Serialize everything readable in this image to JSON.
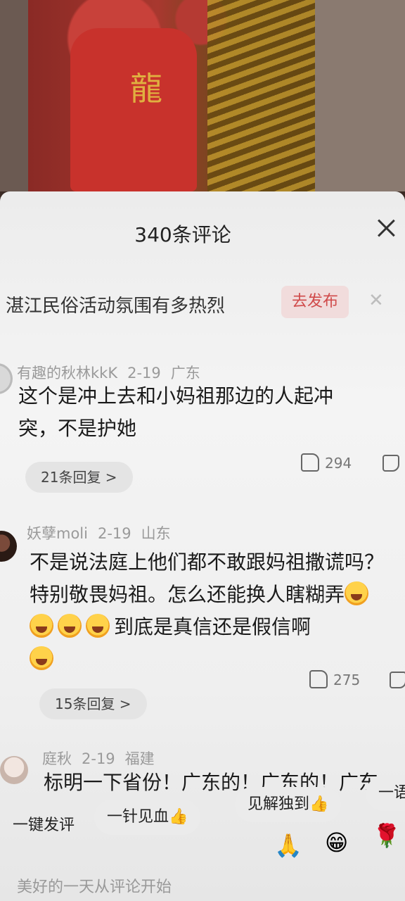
{
  "sheet": {
    "title": "340条评论"
  },
  "topic": {
    "text": "湛江民俗活动氛围有多热烈",
    "publish_label": "去发布"
  },
  "comments": [
    {
      "user": "有趣的秋林kkK",
      "date": "2-19",
      "location": "广东",
      "text": "这个是冲上去和小妈祖那边的人起冲突，不是护她",
      "likes": "294",
      "replies": "21条回复 >"
    },
    {
      "user": "妖孽moli",
      "date": "2-19",
      "location": "山东",
      "text": "不是说法庭上他们都不敢跟妈祖撒谎吗？特别敬畏妈祖。怎么还能换人瞎糊弄",
      "text_after": "到底是真信还是假信啊",
      "likes": "275",
      "replies": "15条回复 >"
    },
    {
      "user": "庭秋",
      "date": "2-19",
      "location": "福建",
      "text": "标明一下省份！广东的！广东的！广东"
    }
  ],
  "quick_replies": [
    "一键发评",
    "一针见血👍",
    "见解独到👍",
    "一语"
  ],
  "emoji_bar": [
    "🙏",
    "😁",
    "🌹"
  ],
  "input": {
    "placeholder": "美好的一天从评论开始"
  }
}
